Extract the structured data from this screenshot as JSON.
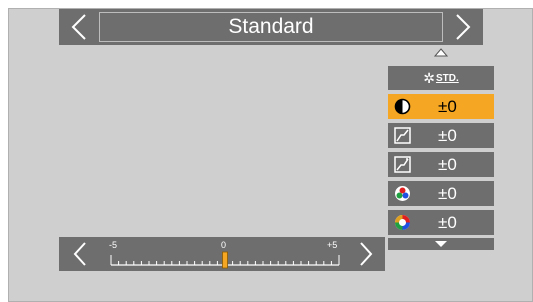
{
  "header": {
    "title": "Standard"
  },
  "style_row": {
    "label": "STD."
  },
  "params": [
    {
      "name": "contrast",
      "icon": "contrast-icon",
      "value": "±0",
      "active": true
    },
    {
      "name": "highlight",
      "icon": "highlight-icon",
      "value": "±0",
      "active": false
    },
    {
      "name": "shadow",
      "icon": "shadow-icon",
      "value": "±0",
      "active": false
    },
    {
      "name": "saturation",
      "icon": "saturation-icon",
      "value": "±0",
      "active": false
    },
    {
      "name": "color-tone",
      "icon": "color-tone-icon",
      "value": "±0",
      "active": false
    }
  ],
  "slider": {
    "min_label": "-5",
    "mid_label": "0",
    "max_label": "+5",
    "min": -5,
    "max": 5,
    "value": 0
  },
  "colors": {
    "panel": "#6e6e6e",
    "highlight": "#f5a623",
    "background": "#cfcfcf",
    "text": "#ffffff"
  }
}
